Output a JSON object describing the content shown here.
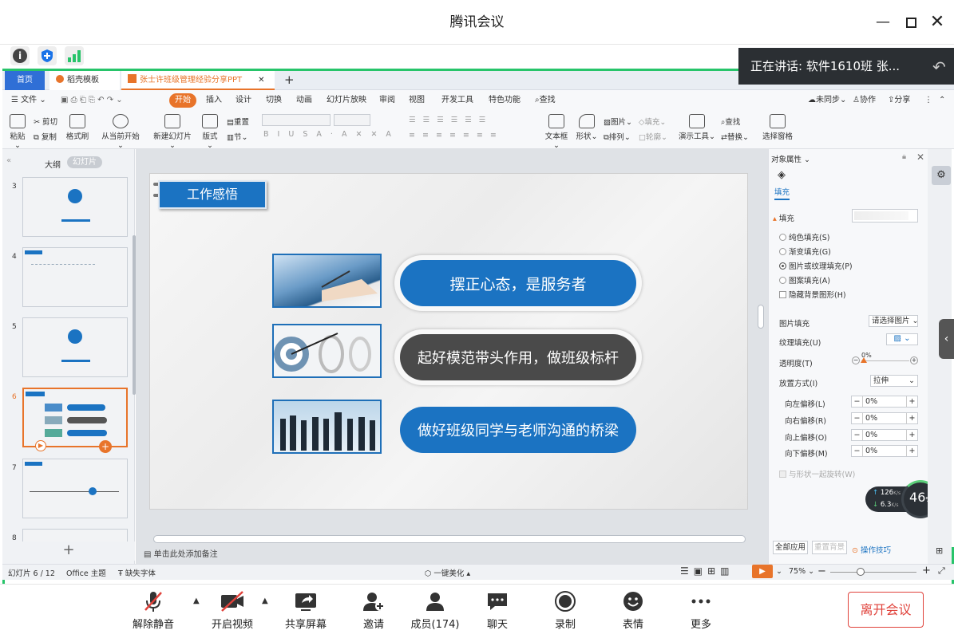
{
  "app": {
    "title": "腾讯会议"
  },
  "speaker": {
    "label": "正在讲话: 软件1610班 张..."
  },
  "wps": {
    "tabs": {
      "home": "首页",
      "template": "稻壳模板",
      "doc": "张士许班级管理经验分享PPT"
    },
    "menu": [
      "文件",
      "开始",
      "插入",
      "设计",
      "切换",
      "动画",
      "幻灯片放映",
      "审阅",
      "视图",
      "开发工具",
      "特色功能",
      "查找"
    ],
    "menu_right": {
      "sync": "未同步",
      "collab": "协作",
      "share": "分享"
    },
    "ribbon": {
      "paste": "粘贴",
      "cut": "剪切",
      "copy": "复制",
      "format_painter": "格式刷",
      "play_from_current": "从当前开始",
      "new_slide": "新建幻灯片",
      "layout": "版式",
      "reset": "重置",
      "section": "节",
      "textbox": "文本框",
      "shape": "形状",
      "picture": "图片",
      "fill": "填充",
      "arrange": "排列",
      "outline": "轮廓",
      "presenter_tools": "演示工具",
      "find": "查找",
      "replace": "替换",
      "select_pane": "选择窗格"
    },
    "left_panel": {
      "tab_outline": "大纲",
      "tab_slides": "幻灯片",
      "slide_numbers": [
        "3",
        "4",
        "5",
        "6",
        "7",
        "8"
      ]
    },
    "slide": {
      "header": "工作感悟",
      "points": [
        "摆正心态，是服务者",
        "起好模范带头作用，做班级标杆",
        "做好班级同学与老师沟通的桥梁"
      ]
    },
    "notes_placeholder": "单击此处添加备注",
    "right_panel": {
      "title": "对象属性",
      "fill_tab": "填充",
      "fill_section": "填充",
      "options": [
        "纯色填充(S)",
        "渐变填充(G)",
        "图片或纹理填充(P)",
        "图案填充(A)"
      ],
      "hide_bg": "隐藏背景图形(H)",
      "picture_fill": "图片填充",
      "picture_fill_value": "请选择图片",
      "texture_fill": "纹理填充(U)",
      "transparency": "透明度(T)",
      "transparency_value": "0%",
      "stretch": "放置方式(I)",
      "stretch_value": "拉伸",
      "offsets": [
        {
          "label": "向左偏移(L)",
          "value": "0%"
        },
        {
          "label": "向右偏移(R)",
          "value": "0%"
        },
        {
          "label": "向上偏移(O)",
          "value": "0%"
        },
        {
          "label": "向下偏移(M)",
          "value": "0%"
        }
      ],
      "rotate_with_shape": "与形状一起旋转(W)",
      "apply_all": "全部应用",
      "reset_bg": "重置背景",
      "tips": "操作技巧"
    },
    "network": {
      "up": "126",
      "down": "6.3",
      "unit": "K/s",
      "cpu": "46",
      "cpu_unit": "%"
    },
    "status": {
      "slide_pos": "幻灯片 6 / 12",
      "theme": "Office 主题",
      "missing_font": "缺失字体",
      "beautify": "一键美化",
      "zoom": "75%"
    }
  },
  "toolbar": {
    "mute": "解除静音",
    "video": "开启视频",
    "share": "共享屏幕",
    "invite": "邀请",
    "members": "成员(174)",
    "chat": "聊天",
    "record": "录制",
    "emoji": "表情",
    "more": "更多",
    "leave": "离开会议"
  },
  "colors": {
    "accent_blue": "#1b73c2",
    "leave_red": "#e0423b",
    "green": "#27c46a",
    "wps_orange": "#e8742a"
  }
}
